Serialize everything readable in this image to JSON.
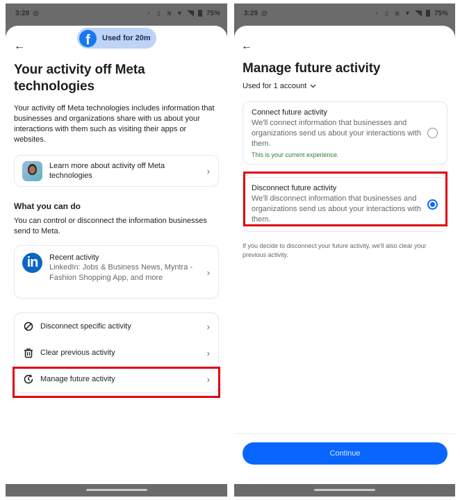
{
  "left_screen": {
    "status_bar": {
      "time": "3:28",
      "battery": "75%"
    },
    "usage_pill": {
      "app_icon": "facebook-logo",
      "label": "Used for 20m"
    },
    "back_icon": "arrow-left-icon",
    "title": "Your activity off Meta technologies",
    "description": "Your activity off Meta technologies includes information that businesses and organizations share with us about your interactions with them such as visiting their apps or websites.",
    "learn_more": {
      "label": "Learn more about activity off Meta technologies",
      "icon": "avatar-illustration"
    },
    "section": {
      "title": "What you can do",
      "description": "You can control or disconnect the information businesses send to Meta."
    },
    "recent_activity": {
      "title": "Recent activity",
      "subtitle": "LinkedIn: Jobs & Business News, Myntra - Fashion Shopping App, and more",
      "icon": "linkedin-logo"
    },
    "actions": [
      {
        "label": "Disconnect specific activity",
        "icon": "block-icon"
      },
      {
        "label": "Clear previous activity",
        "icon": "trash-icon"
      },
      {
        "label": "Manage future activity",
        "icon": "clock-history-icon",
        "highlighted": true
      }
    ]
  },
  "right_screen": {
    "status_bar": {
      "time": "3:29",
      "battery": "75%"
    },
    "back_icon": "arrow-left-icon",
    "title": "Manage future activity",
    "account_selector": {
      "label": "Used for 1 account",
      "icon": "chevron-down-icon"
    },
    "options": [
      {
        "title": "Connect future activity",
        "description": "We'll connect information that businesses and organizations send us about your interactions with them.",
        "note": "This is your current experience.",
        "selected": false
      },
      {
        "title": "Disconnect future activity",
        "description": "We'll disconnect information that businesses and organizations send us about your interactions with them.",
        "selected": true,
        "highlighted": true
      }
    ],
    "footnote": "If you decide to disconnect your future activity, we'll also clear your previous activity.",
    "continue_label": "Continue"
  },
  "colors": {
    "primary": "#0866ff",
    "highlight": "#e0000f",
    "facebook": "#1877f2",
    "linkedin": "#0a66c2",
    "note_green": "#2e7d32"
  }
}
